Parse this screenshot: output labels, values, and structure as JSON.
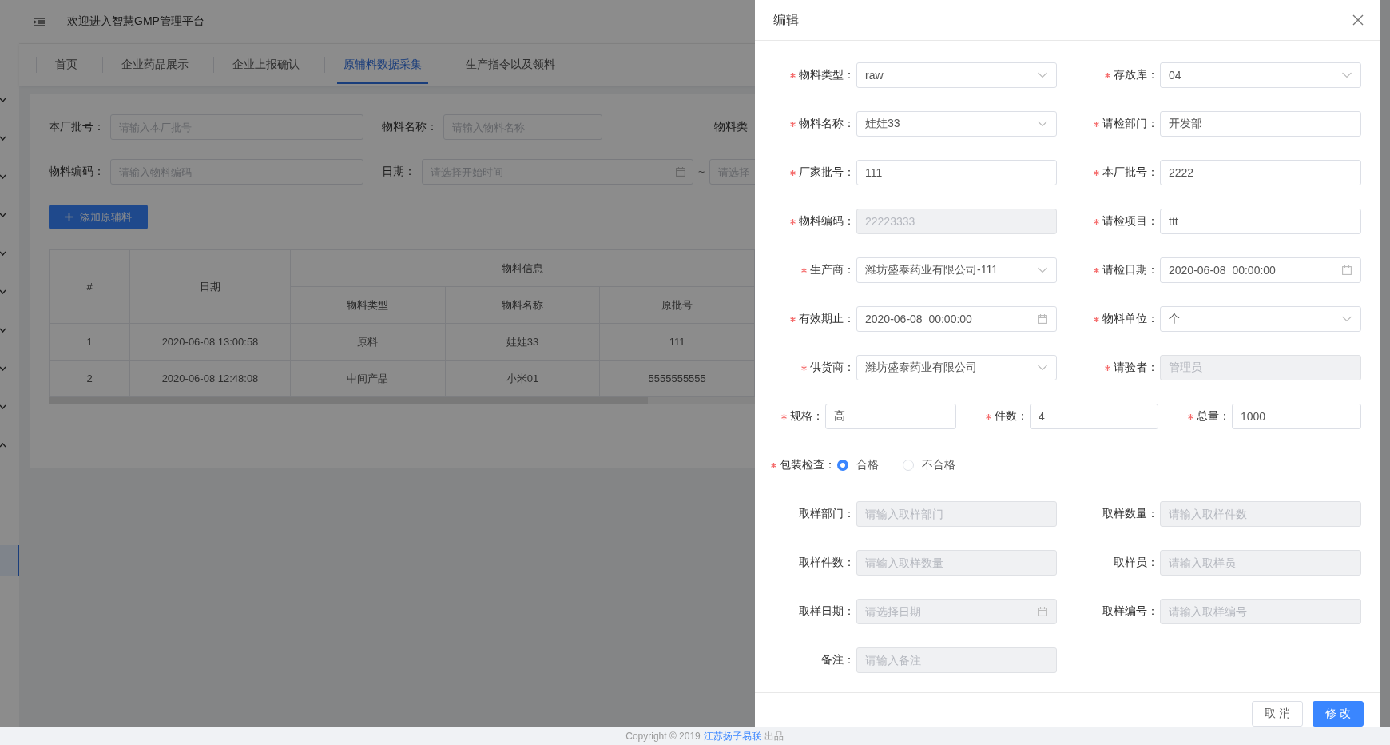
{
  "sidebar": {
    "groups": [
      {
        "expanded": false
      },
      {
        "expanded": false
      },
      {
        "expanded": false
      },
      {
        "expanded": false
      },
      {
        "expanded": false
      },
      {
        "expanded": false
      },
      {
        "expanded": false
      },
      {
        "expanded": false
      },
      {
        "expanded": false
      },
      {
        "expanded": true
      }
    ],
    "menu_items": [
      {
        "selected": true
      }
    ]
  },
  "header": {
    "title": "欢迎进入智慧GMP管理平台"
  },
  "tabs": [
    {
      "label": "首页",
      "selected": false
    },
    {
      "label": "企业药品展示",
      "selected": false
    },
    {
      "label": "企业上报确认",
      "selected": false
    },
    {
      "label": "原辅料数据采集",
      "selected": true
    },
    {
      "label": "生产指令以及领料",
      "selected": false
    }
  ],
  "search": {
    "rows": [
      [
        {
          "kind": "input",
          "label": "本厂批号：",
          "placeholder": "请输入本厂批号"
        },
        {
          "kind": "input",
          "label": "物料名称：",
          "placeholder": "请输入物料名称"
        },
        {
          "kind": "label",
          "label": "物料类"
        }
      ],
      [
        {
          "kind": "input",
          "label": "物料编码：",
          "placeholder": "请输入物料编码"
        },
        {
          "kind": "date_range",
          "label": "日期：",
          "placeholder": "请选择开始时间",
          "separator": "~",
          "end_placeholder": "请选择"
        }
      ]
    ]
  },
  "add_button": {
    "label": "添加原辅料"
  },
  "table": {
    "group_header": "物料信息",
    "columns": [
      "#",
      "日期",
      "物料类型",
      "物料名称",
      "原批号"
    ],
    "rows": [
      [
        "1",
        "2020-06-08 13:00:58",
        "原料",
        "娃娃33",
        "111"
      ],
      [
        "2",
        "2020-06-08 12:48:08",
        "中间产品",
        "小米01",
        "5555555555"
      ]
    ]
  },
  "drawer": {
    "title": "编辑",
    "rows": [
      {
        "fields": [
          {
            "kind": "select",
            "label": "物料类型：",
            "required": true,
            "value": "raw"
          },
          {
            "kind": "select",
            "label": "存放库：",
            "required": true,
            "value": "04"
          }
        ]
      },
      {
        "fields": [
          {
            "kind": "select",
            "label": "物料名称：",
            "required": true,
            "value": "娃娃33"
          },
          {
            "kind": "input",
            "label": "请检部门：",
            "required": true,
            "value": "开发部"
          }
        ]
      },
      {
        "fields": [
          {
            "kind": "input",
            "label": "厂家批号：",
            "required": true,
            "value": "111"
          },
          {
            "kind": "input",
            "label": "本厂批号：",
            "required": true,
            "value": "2222"
          }
        ]
      },
      {
        "fields": [
          {
            "kind": "input",
            "label": "物料编码：",
            "required": true,
            "value": "22223333",
            "disabled": true
          },
          {
            "kind": "input",
            "label": "请检项目：",
            "required": true,
            "value": "ttt"
          }
        ]
      },
      {
        "fields": [
          {
            "kind": "select",
            "label": "生产商：",
            "required": true,
            "value": "潍坊盛泰药业有限公司-111"
          },
          {
            "kind": "date",
            "label": "请检日期：",
            "required": true,
            "value": "2020-06-08  00:00:00"
          }
        ]
      },
      {
        "fields": [
          {
            "kind": "date",
            "label": "有效期止：",
            "required": true,
            "value": "2020-06-08  00:00:00"
          },
          {
            "kind": "select",
            "label": "物料单位：",
            "required": true,
            "value": "个"
          }
        ]
      },
      {
        "fields": [
          {
            "kind": "select",
            "label": "供货商：",
            "required": true,
            "value": "潍坊盛泰药业有限公司"
          },
          {
            "kind": "input",
            "label": "请验者：",
            "required": true,
            "value": "管理员",
            "disabled": true
          }
        ]
      },
      {
        "fields": [
          {
            "kind": "input",
            "label": "规格：",
            "required": true,
            "value": "高"
          },
          {
            "kind": "input",
            "label": "件数：",
            "required": true,
            "value": "4"
          },
          {
            "kind": "input",
            "label": "总量：",
            "required": true,
            "value": "1000"
          }
        ]
      },
      {
        "fields": [
          {
            "kind": "radio",
            "label": "包装检查：",
            "required": true,
            "options": [
              {
                "label": "合格",
                "selected": true
              },
              {
                "label": "不合格",
                "selected": false
              }
            ]
          }
        ]
      },
      {
        "fields": [
          {
            "kind": "input",
            "label": "取样部门：",
            "required": false,
            "placeholder": "请输入取样部门",
            "disabled": true
          },
          {
            "kind": "input",
            "label": "取样数量：",
            "required": false,
            "placeholder": "请输入取样件数",
            "disabled": true
          }
        ]
      },
      {
        "fields": [
          {
            "kind": "input",
            "label": "取样件数：",
            "required": false,
            "placeholder": "请输入取样数量",
            "disabled": true
          },
          {
            "kind": "input",
            "label": "取样员：",
            "required": false,
            "placeholder": "请输入取样员",
            "disabled": true
          }
        ]
      },
      {
        "fields": [
          {
            "kind": "date",
            "label": "取样日期：",
            "required": false,
            "placeholder": "请选择日期",
            "disabled": true
          },
          {
            "kind": "input",
            "label": "取样编号：",
            "required": false,
            "placeholder": "请输入取样编号",
            "disabled": true
          }
        ]
      },
      {
        "fields": [
          {
            "kind": "input",
            "label": "备注：",
            "required": false,
            "placeholder": "请输入备注",
            "disabled": true
          }
        ]
      }
    ],
    "buttons": [
      {
        "kind": "default",
        "label": "取 消"
      },
      {
        "kind": "primary",
        "label": "修 改"
      }
    ]
  },
  "footer": {
    "copyright": "Copyright © 2019",
    "link": "江苏扬子易联",
    "suffix": "出品"
  }
}
